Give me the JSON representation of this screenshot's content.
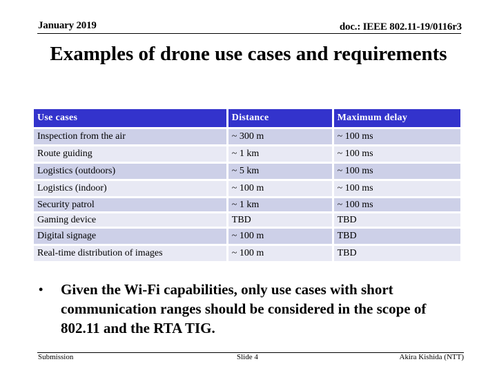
{
  "header": {
    "date": "January 2019",
    "doc_id": "doc.: IEEE 802.11-19/0116r3"
  },
  "title": "Examples of drone use cases and requirements",
  "table": {
    "columns": [
      "Use cases",
      "Distance",
      "Maximum delay"
    ],
    "rows": [
      {
        "use_case": "Inspection from the air",
        "distance": "~ 300 m",
        "delay": "~ 100 ms"
      },
      {
        "use_case": "Route guiding",
        "distance": "~ 1 km",
        "delay": "~ 100 ms"
      },
      {
        "use_case": "Logistics (outdoors)",
        "distance": "~ 5 km",
        "delay": "~ 100 ms"
      },
      {
        "use_case": "Logistics (indoor)",
        "distance": "~ 100 m",
        "delay": "~ 100 ms"
      },
      {
        "use_case": "Security patrol",
        "distance": "~ 1 km",
        "delay": "~ 100 ms"
      },
      {
        "use_case": "Gaming device",
        "distance": "TBD",
        "delay": "TBD"
      },
      {
        "use_case": "Digital signage",
        "distance": "~ 100 m",
        "delay": "TBD"
      },
      {
        "use_case": "Real-time distribution of images",
        "distance": "~ 100 m",
        "delay": "TBD"
      }
    ]
  },
  "bullet": {
    "symbol": "•",
    "text": "Given the Wi-Fi capabilities, only use cases with short communication ranges should be considered in the scope of 802.11 and the RTA TIG."
  },
  "footer": {
    "left": "Submission",
    "center": "Slide 4",
    "right": "Akira Kishida (NTT)"
  },
  "colors": {
    "header_bg": "#3333cc",
    "row_odd": "#cdd0e8",
    "row_even": "#e8e9f4"
  }
}
